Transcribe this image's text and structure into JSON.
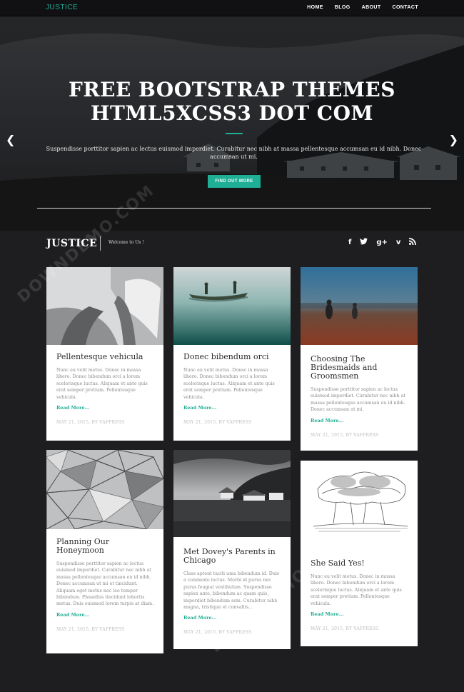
{
  "nav": {
    "brand": "JUSTICE",
    "links": [
      "HOME",
      "BLOG",
      "ABOUT",
      "CONTACT"
    ]
  },
  "hero": {
    "title_line1": "FREE BOOTSTRAP THEMES",
    "title_line2": "HTML5XCSS3 DOT COM",
    "subtitle": "Suspendisse porttitor sapien ac lectus euismod imperdiet. Curabitur nec nibh at massa pellentesque accumsan eu id nibh. Donec accumsan ut mi.",
    "button": "FIND OUT MORE",
    "prev_icon": "chevron-left-icon",
    "next_icon": "chevron-right-icon"
  },
  "section": {
    "name": "JUSTICE",
    "welcome": "Welcome to Us !",
    "social": [
      "f",
      "t",
      "g+",
      "v",
      "rss"
    ]
  },
  "cards": [
    {
      "title": "Pellentesque vehicula",
      "text": "Nunc eu velit metus. Donec in massa libero. Donec bibendum orci a lorem scelerisque luctus. Aliquam et ante quis erat semper pretium. Pellentesque vehicula.",
      "more": "Read More...",
      "meta": "MAY 21, 2015, BY VAFPRESS"
    },
    {
      "title": "Donec bibendum orci",
      "text": "Nunc eu velit metus. Donec in massa libero. Donec bibendum orci a lorem scelerisque luctus. Aliquam et ante quis erat semper pretium. Pellentesque vehicula.",
      "more": "Read More...",
      "meta": "MAY 21, 2015, BY VAFPRESS"
    },
    {
      "title": "Choosing The Bridesmaids and Groomsmen",
      "text": "Suspendisse porttitor sapien ac lectus euismod imperdiet. Curabitur nec nibh at massa pellentesque accumsan eu id nibh. Donec accumsan ut mi.",
      "more": "Read More...",
      "meta": "MAY 21, 2015, BY VAFPRESS"
    },
    {
      "title": "Planning Our Honeymoon",
      "text": "Suspendisse porttitor sapien ac lectus euismod imperdiet. Curabitur nec nibh at massa pellentesque accumsan eu id nibh. Donec accumsan ut mi et tincidunt. Aliquam eget metus nec leo tempor bibendum. Phasellus tincidunt lobortis metus. Duis euismod lorem turpis at diam.",
      "more": "Read More...",
      "meta": "MAY 21, 2015, BY VAFPRESS"
    },
    {
      "title": "Met Dovey's Parents in Chicago",
      "text": "Class aptent taciti uma bibendum id. Duis a commodo lectus. Morbi id purus nec purus feugiat vestibulum. Suspendisse sapien ante, bibendum ac quam quis, imperdiet bibendum sem. Curabitur nibh magna, tristique et convallis...",
      "more": "Read More...",
      "meta": "MAY 21, 2015, BY VAFPRESS"
    },
    {
      "title": "She Said Yes!",
      "text": "Nunc eu velit metus. Donec in massa libero. Donec bibendum orci a lorem scelerisque luctus. Aliquam et ante quis erat semper pretium. Pellentesque vehicula.",
      "more": "Read More...",
      "meta": "MAY 21, 2015, BY VAFPRESS"
    }
  ],
  "watermark": "DOWNDEMO.COM",
  "colors": {
    "accent": "#1fae96",
    "background": "#1e1e20",
    "navbar": "#111113"
  }
}
